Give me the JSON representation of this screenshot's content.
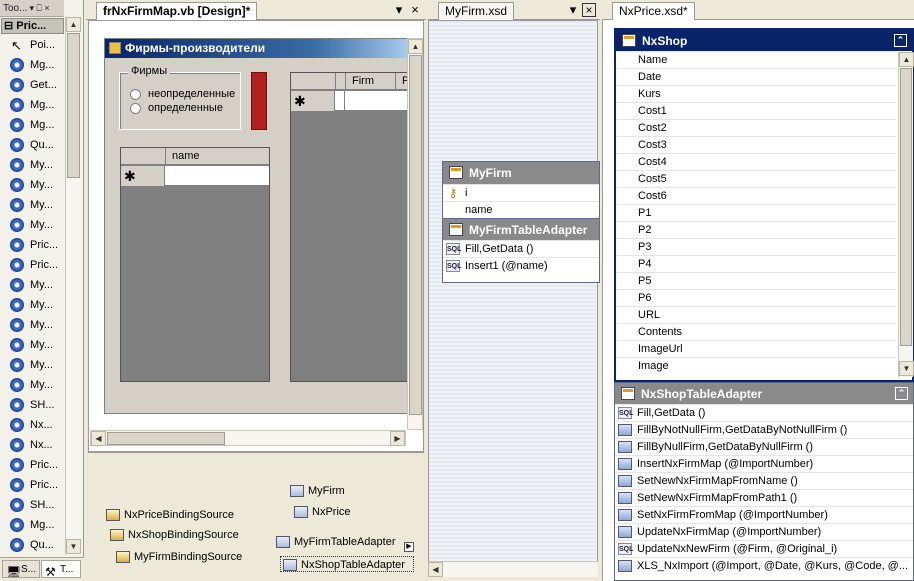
{
  "toolbox": {
    "title": "Too...",
    "pin": "▾ ⎕ ×",
    "header": "⊟ Pric...",
    "items": [
      {
        "label": "Poi...",
        "icon": "arrow-pointer-icon"
      },
      {
        "label": "Mg...",
        "icon": "gear-icon"
      },
      {
        "label": "Get...",
        "icon": "gear-icon"
      },
      {
        "label": "Mg...",
        "icon": "gear-icon"
      },
      {
        "label": "Mg...",
        "icon": "gear-icon"
      },
      {
        "label": "Qu...",
        "icon": "gear-icon"
      },
      {
        "label": "My...",
        "icon": "gear-icon"
      },
      {
        "label": "My...",
        "icon": "gear-icon"
      },
      {
        "label": "My...",
        "icon": "gear-icon"
      },
      {
        "label": "My...",
        "icon": "gear-icon"
      },
      {
        "label": "Pric...",
        "icon": "gear-icon"
      },
      {
        "label": "Pric...",
        "icon": "gear-icon"
      },
      {
        "label": "My...",
        "icon": "gear-icon"
      },
      {
        "label": "My...",
        "icon": "gear-icon"
      },
      {
        "label": "My...",
        "icon": "gear-icon"
      },
      {
        "label": "My...",
        "icon": "gear-icon"
      },
      {
        "label": "My...",
        "icon": "gear-icon"
      },
      {
        "label": "My...",
        "icon": "gear-icon"
      },
      {
        "label": "SH...",
        "icon": "gear-icon"
      },
      {
        "label": "Nx...",
        "icon": "gear-icon"
      },
      {
        "label": "Nx...",
        "icon": "gear-icon"
      },
      {
        "label": "Pric...",
        "icon": "gear-icon"
      },
      {
        "label": "Pric...",
        "icon": "gear-icon"
      },
      {
        "label": "SH...",
        "icon": "gear-icon"
      },
      {
        "label": "Mg...",
        "icon": "gear-icon"
      },
      {
        "label": "Qu...",
        "icon": "gear-icon"
      }
    ],
    "bottom_tabs": [
      "S...",
      "T..."
    ]
  },
  "designer": {
    "tab": "frNxFirmMap.vb [Design]*",
    "form_title": "Фирмы-производители",
    "group_label": "Фирмы",
    "radio1": "неопределенные",
    "radio2": "определенные",
    "grid_left_col": "name",
    "grid_right_cols": [
      "Firm",
      "P"
    ],
    "new_row_marker": "✱",
    "tray": [
      {
        "label": "NxPriceBindingSource",
        "kind": "binding-source"
      },
      {
        "label": "NxShopBindingSource",
        "kind": "binding-source"
      },
      {
        "label": "MyFirmBindingSource",
        "kind": "binding-source"
      },
      {
        "label": "MyFirm",
        "kind": "dataset"
      },
      {
        "label": "NxPrice",
        "kind": "dataset"
      },
      {
        "label": "MyFirmTableAdapter",
        "kind": "adapter"
      },
      {
        "label": "NxShopTableAdapter",
        "kind": "adapter"
      }
    ]
  },
  "myfirm_xsd": {
    "tab": "MyFirm.xsd",
    "table": {
      "name": "MyFirm",
      "columns": [
        "i",
        "name"
      ]
    },
    "adapter": {
      "name": "MyFirmTableAdapter",
      "queries": [
        "Fill,GetData ()",
        "Insert1 (@name)"
      ]
    }
  },
  "nxprice_xsd": {
    "tab": "NxPrice.xsd*",
    "table": {
      "name": "NxShop",
      "columns": [
        "Name",
        "Date",
        "Kurs",
        "Cost1",
        "Cost2",
        "Cost3",
        "Cost4",
        "Cost5",
        "Cost6",
        "P1",
        "P2",
        "P3",
        "P4",
        "P5",
        "P6",
        "URL",
        "Contents",
        "ImageUrl",
        "Image"
      ]
    },
    "adapter": {
      "name": "NxShopTableAdapter",
      "queries": [
        {
          "label": "Fill,GetData ()",
          "icon": "sql-icon"
        },
        {
          "label": "FillByNotNullFirm,GetDataByNotNullFirm ()",
          "icon": "query-icon"
        },
        {
          "label": "FillByNullFirm,GetDataByNullFirm ()",
          "icon": "query-icon"
        },
        {
          "label": "InsertNxFirmMap (@ImportNumber)",
          "icon": "query-icon"
        },
        {
          "label": "SetNewNxFirmMapFromName ()",
          "icon": "query-icon"
        },
        {
          "label": "SetNewNxFirmMapFromPath1 ()",
          "icon": "query-icon"
        },
        {
          "label": "SetNxFirmFromMap (@ImportNumber)",
          "icon": "query-icon"
        },
        {
          "label": "UpdateNxFirmMap (@ImportNumber)",
          "icon": "query-icon"
        },
        {
          "label": "UpdateNxNewFirm (@Firm, @Original_i)",
          "icon": "sql-icon"
        },
        {
          "label": "XLS_NxImport (@Import, @Date, @Kurs, @Code, @...",
          "icon": "query-icon"
        }
      ]
    }
  },
  "colors": {
    "selection_border": "#0a246a",
    "table_header": "#0a246a",
    "form_title": "#0a246a",
    "red_button": "#b02020"
  }
}
